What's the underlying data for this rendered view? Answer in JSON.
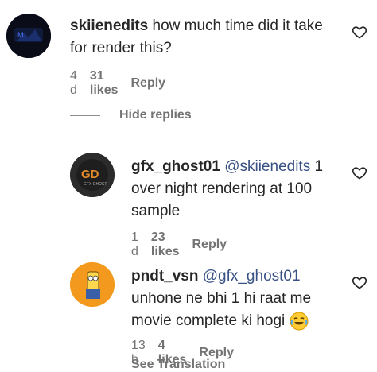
{
  "comments": [
    {
      "username": "skiienedits",
      "mention": "",
      "text": "how much time did it take for render this?",
      "time": "4 d",
      "likes": "31 likes",
      "reply": "Reply"
    },
    {
      "username": "gfx_ghost01",
      "mention": "@skiienedits",
      "text": "1 over night rendering at 100 sample",
      "time": "1 d",
      "likes": "23 likes",
      "reply": "Reply"
    },
    {
      "username": "pndt_vsn",
      "mention": "@gfx_ghost01",
      "text": "unhone ne bhi 1 hi raat me movie complete ki hogi",
      "time": "13 h",
      "likes": "4 likes",
      "reply": "Reply"
    }
  ],
  "hide_replies_label": "Hide replies",
  "cut_text": "See Translation",
  "icons": {
    "like": "heart-icon",
    "emoji": "laughing-tears-emoji"
  },
  "colors": {
    "text": "#262626",
    "meta": "#737373",
    "mention": "#385185"
  }
}
